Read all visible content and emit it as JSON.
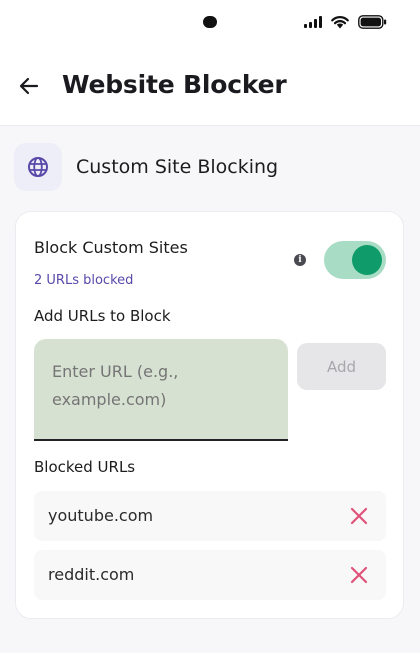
{
  "header": {
    "title": "Website Blocker",
    "back_icon": "arrow-left-icon"
  },
  "section": {
    "title": "Custom Site Blocking",
    "icon": "globe-icon"
  },
  "block_toggle": {
    "label": "Block Custom Sites",
    "count_text": "2 URLs blocked",
    "info_glyph": "i",
    "enabled": true
  },
  "add_urls": {
    "label": "Add URLs to Block",
    "input_placeholder": "Enter URL (e.g., example.com)",
    "input_value": "",
    "add_label": "Add"
  },
  "blocked": {
    "label": "Blocked URLs",
    "items": [
      {
        "url": "youtube.com"
      },
      {
        "url": "reddit.com"
      }
    ]
  },
  "colors": {
    "accent": "#5a48a8",
    "toggle_track": "#a8dcc5",
    "toggle_thumb": "#0f9c6a",
    "input_bg": "#d7e1d2",
    "remove_icon": "#e0527a"
  }
}
